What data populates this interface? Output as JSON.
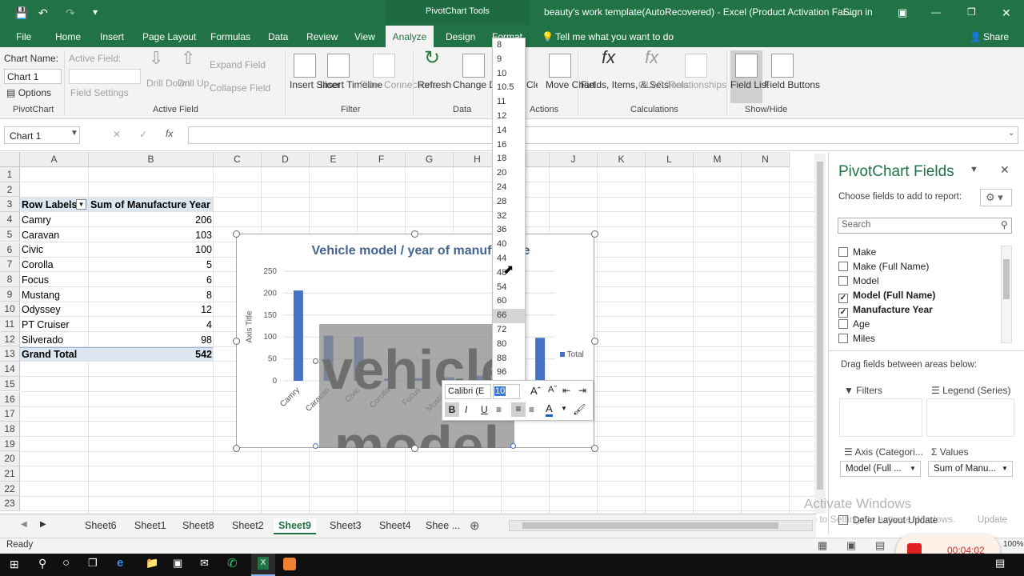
{
  "titlebar": {
    "contextual": "PivotChart Tools",
    "title": "beauty's work template(AutoRecovered)  -  Excel (Product Activation Fai...",
    "signin": "Sign in"
  },
  "tabs": {
    "file": "File",
    "home": "Home",
    "insert": "Insert",
    "page_layout": "Page Layout",
    "formulas": "Formulas",
    "data": "Data",
    "review": "Review",
    "view": "View",
    "analyze": "Analyze",
    "design": "Design",
    "format": "Format",
    "tell_me": "Tell me what you want to do",
    "share": "Share"
  },
  "ribbon": {
    "chart_name_label": "Chart Name:",
    "chart_name_value": "Chart 1",
    "options": "Options",
    "pivotchart_group": "PivotChart",
    "active_field_label": "Active Field:",
    "field_settings": "Field Settings",
    "drill_down": "Drill Down",
    "drill_up": "Drill Up",
    "expand_field": "Expand Field",
    "collapse_field": "Collapse Field",
    "active_field_group": "Active Field",
    "insert_slicer": "Insert Slicer",
    "insert_timeline": "Insert Timeline",
    "filter_connections": "Filter Connections",
    "filter_group": "Filter",
    "refresh": "Refresh",
    "change_data_source": "Change Data Source",
    "data_group": "Data",
    "clear": "Clear",
    "move_chart": "Move Chart",
    "actions_group": "Actions",
    "fields_items_sets": "Fields, Items, & Sets",
    "olap_tools": "OLAP Tools",
    "relationships": "Relationships",
    "calculations_group": "Calculations",
    "field_list": "Field List",
    "field_buttons": "Field Buttons",
    "show_hide_group": "Show/Hide"
  },
  "formula_bar": {
    "namebox": "Chart 1",
    "fx": "fx",
    "cancel": "✕",
    "enter": "✓"
  },
  "columns": [
    "A",
    "B",
    "C",
    "D",
    "E",
    "F",
    "G",
    "H",
    "I",
    "J",
    "K",
    "L",
    "M",
    "N"
  ],
  "rows": [
    "1",
    "2",
    "3",
    "4",
    "5",
    "6",
    "7",
    "8",
    "9",
    "10",
    "11",
    "12",
    "13",
    "14",
    "15",
    "16",
    "17",
    "18",
    "19",
    "20",
    "21",
    "22",
    "23"
  ],
  "pivot": {
    "header_labels": "Row Labels",
    "header_sum": "Sum of Manufacture Year",
    "rows": [
      {
        "label": "Camry",
        "value": "206"
      },
      {
        "label": "Caravan",
        "value": "103"
      },
      {
        "label": "Civic",
        "value": "100"
      },
      {
        "label": "Corolla",
        "value": "5"
      },
      {
        "label": "Focus",
        "value": "6"
      },
      {
        "label": "Mustang",
        "value": "8"
      },
      {
        "label": "Odyssey",
        "value": "12"
      },
      {
        "label": "PT Cruiser",
        "value": "4"
      },
      {
        "label": "Silverado",
        "value": "98"
      }
    ],
    "total_label": "Grand Total",
    "total_value": "542"
  },
  "chart_data": {
    "type": "bar",
    "title": "Vehicle model / year of manufacture",
    "ylabel": "Axis Title",
    "categories": [
      "Camry",
      "Caravan",
      "Civic",
      "Corolla",
      "Focus",
      "Mustang",
      "Odyssey",
      "PT Cruiser",
      "Silverado"
    ],
    "series": [
      {
        "name": "Total",
        "values": [
          206,
          103,
          100,
          5,
          6,
          8,
          12,
          4,
          98
        ]
      }
    ],
    "yticks": [
      "250",
      "200",
      "150",
      "100",
      "50",
      "0"
    ],
    "ylim": [
      0,
      250
    ],
    "overlay_text": "vehicle model",
    "legend": "right",
    "bar_color": "#4472c4"
  },
  "font_sizes": [
    "8",
    "9",
    "10",
    "10.5",
    "11",
    "12",
    "14",
    "16",
    "18",
    "20",
    "24",
    "28",
    "32",
    "36",
    "40",
    "44",
    "48",
    "54",
    "60",
    "66",
    "72",
    "80",
    "88",
    "96"
  ],
  "minitoolbar": {
    "font": "Calibri (E",
    "size": "10",
    "bold": "B",
    "italic": "I",
    "underline": "U",
    "font_color": "A"
  },
  "pane": {
    "title": "PivotChart Fields",
    "choose": "Choose fields to add to report:",
    "search_placeholder": "Search",
    "fields": [
      {
        "name": "Make",
        "checked": false
      },
      {
        "name": "Make (Full Name)",
        "checked": false
      },
      {
        "name": "Model",
        "checked": false
      },
      {
        "name": "Model (Full Name)",
        "checked": true
      },
      {
        "name": "Manufacture Year",
        "checked": true
      },
      {
        "name": "Age",
        "checked": false
      },
      {
        "name": "Miles",
        "checked": false
      }
    ],
    "drag": "Drag fields between areas below:",
    "filters": "Filters",
    "legend": "Legend (Series)",
    "axis": "Axis (Categori...",
    "values": "Values",
    "axis_item": "Model (Full ...",
    "values_item": "Sum of Manu...",
    "defer": "Defer Layout Update",
    "update": "Update"
  },
  "sheets": [
    "Sheet6",
    "Sheet1",
    "Sheet8",
    "Sheet2",
    "Sheet9",
    "Sheet3",
    "Sheet4",
    "Shee ..."
  ],
  "active_sheet": "Sheet9",
  "status": {
    "ready": "Ready",
    "zoom": "100%"
  },
  "watermark": {
    "line1": "Activate Windows",
    "line2": "Go to Settings to activate Windows."
  },
  "recorder": {
    "time": "00:04:02"
  }
}
